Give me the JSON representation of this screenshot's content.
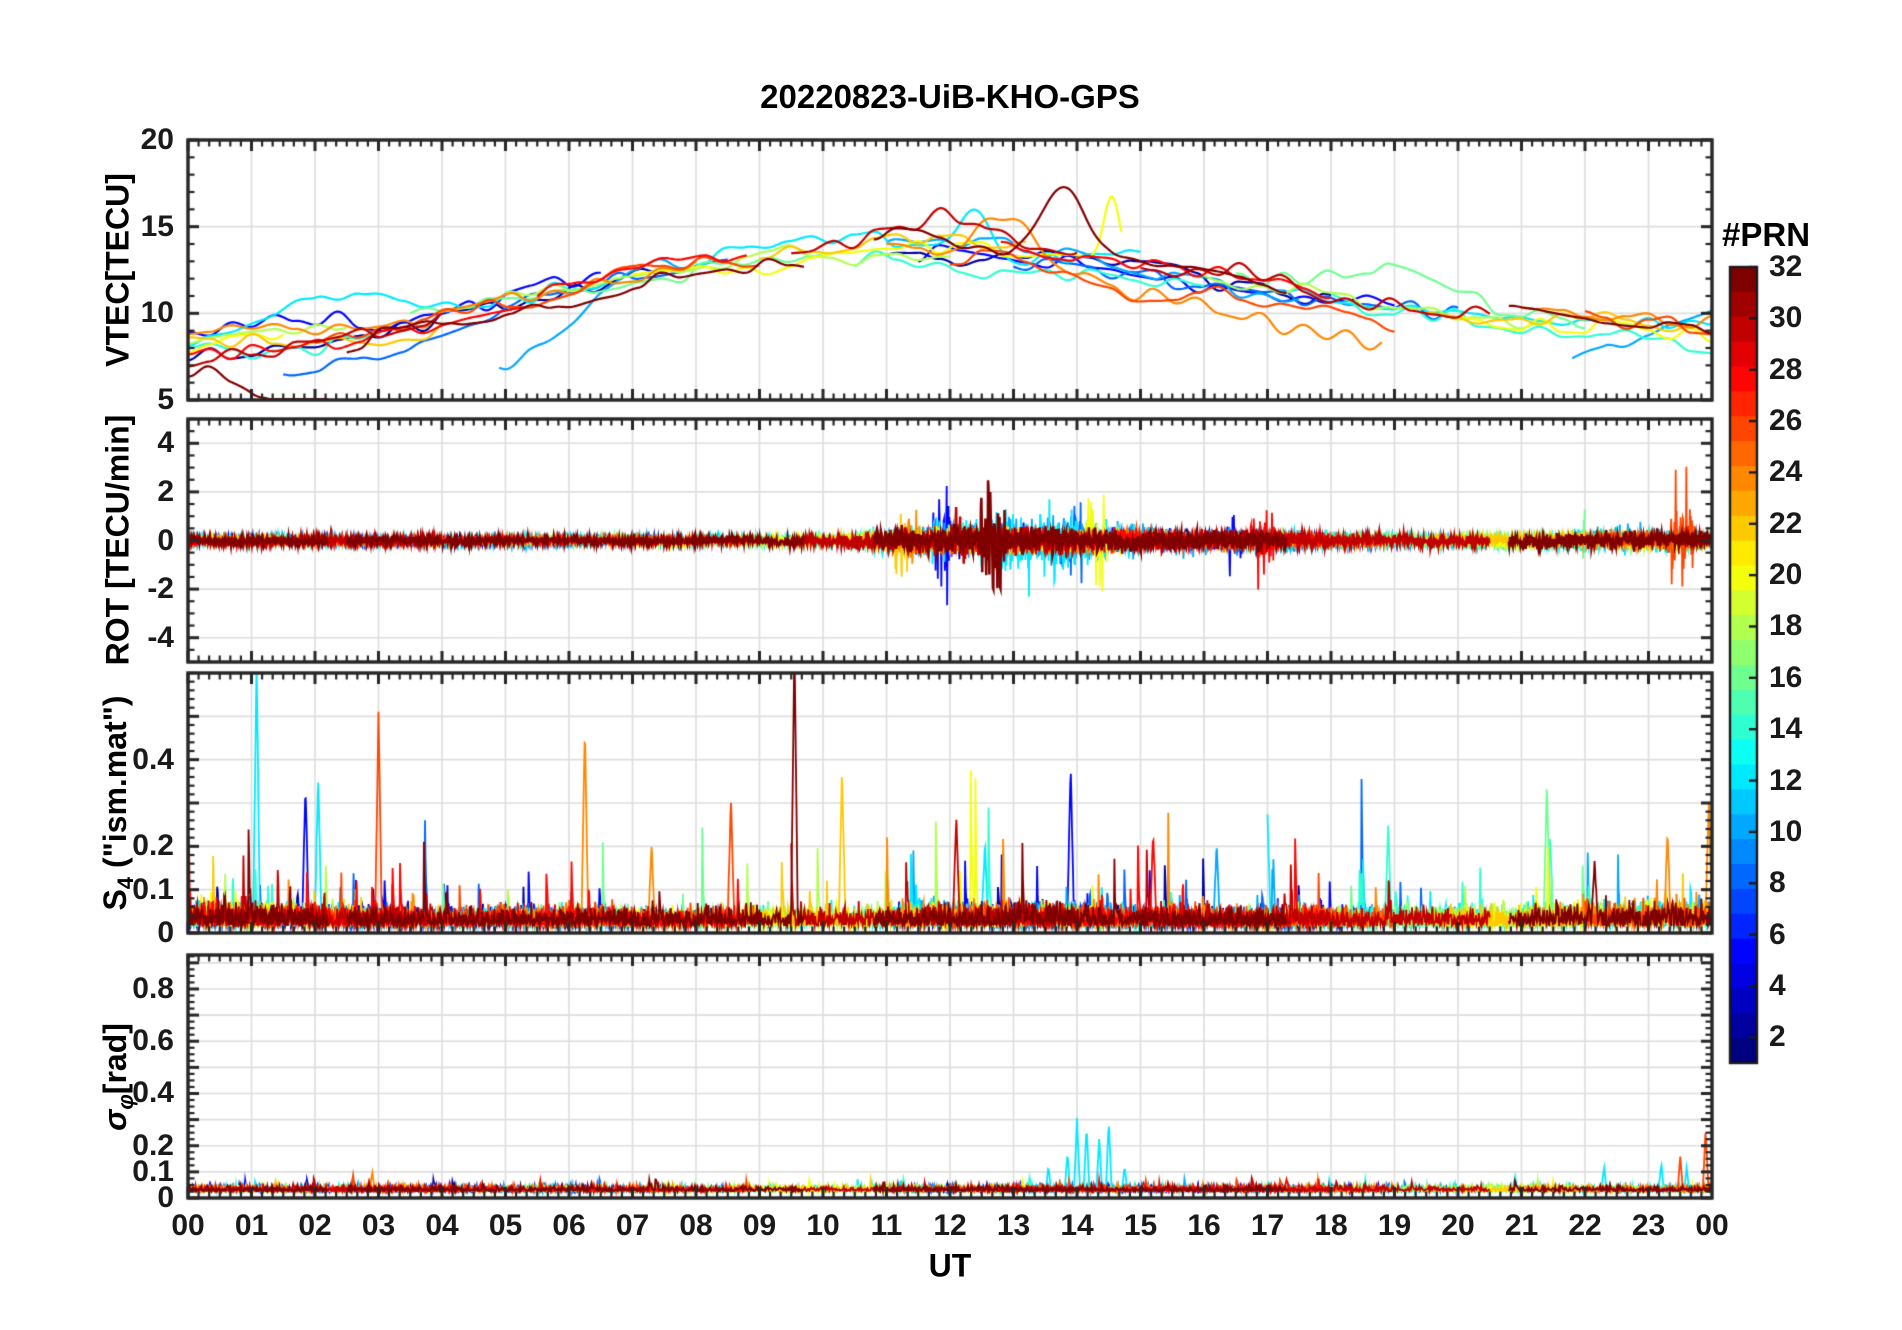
{
  "chart_data": {
    "type": "line",
    "title": "20220823-UiB-KHO-GPS",
    "xlabel": "UT",
    "xlim": [
      0,
      24
    ],
    "x_tick_labels": [
      "00",
      "01",
      "02",
      "03",
      "04",
      "05",
      "06",
      "07",
      "08",
      "09",
      "10",
      "11",
      "12",
      "13",
      "14",
      "15",
      "16",
      "17",
      "18",
      "19",
      "20",
      "21",
      "22",
      "23",
      "00"
    ],
    "grid": true,
    "seed": 20220823,
    "colorbar": {
      "title": "#PRN",
      "min": 1,
      "max": 32,
      "tick_values": [
        32,
        30,
        28,
        26,
        24,
        22,
        20,
        18,
        16,
        14,
        12,
        10,
        8,
        6,
        4,
        2
      ],
      "tick_labels": [
        "32",
        "30",
        "28",
        "26",
        "24",
        "22",
        "20",
        "18",
        "16",
        "14",
        "12",
        "10",
        "8",
        "6",
        "4",
        "2"
      ],
      "colormap": "jet",
      "colors": [
        "#000080",
        "#0000A0",
        "#0000C1",
        "#0000E2",
        "#0004FF",
        "#0025FF",
        "#0046FF",
        "#0067FF",
        "#0088FF",
        "#00A9FF",
        "#00C9FF",
        "#00EAFF",
        "#0CFFF3",
        "#2DFFD2",
        "#4EFFB1",
        "#6FFF90",
        "#90FF6F",
        "#B1FF4E",
        "#D2FF2D",
        "#F3FF0C",
        "#FFEA00",
        "#FFC900",
        "#FFA900",
        "#FF8800",
        "#FF6700",
        "#FF4600",
        "#FF2500",
        "#FF0400",
        "#E20000",
        "#C10000",
        "#A00000",
        "#800000"
      ]
    },
    "panels": [
      {
        "ylabel": "VTEC[TECU]",
        "ylim": [
          5,
          20
        ],
        "ytick_values": [
          5,
          10,
          15,
          20
        ],
        "ytick_labels": [
          "5",
          "10",
          "15",
          "20"
        ],
        "major_ticks": [
          5,
          10,
          15,
          20
        ],
        "grid_y": [
          10,
          15
        ],
        "minor_step": 1,
        "envelope_hourly_mean": [
          8.4,
          8.6,
          8.9,
          9.3,
          9.9,
          10.6,
          11.3,
          12.0,
          12.5,
          12.9,
          13.2,
          13.4,
          13.4,
          13.2,
          12.9,
          12.4,
          11.9,
          11.4,
          10.9,
          10.4,
          10.0,
          9.7,
          9.5,
          9.4,
          9.3
        ],
        "envelope_hourly_spread": [
          1.3,
          1.3,
          1.3,
          1.2,
          1.2,
          1.2,
          1.1,
          1.1,
          1.0,
          1.0,
          1.0,
          1.0,
          1.1,
          1.2,
          1.2,
          1.2,
          1.1,
          1.1,
          1.0,
          1.0,
          1.0,
          1.0,
          1.0,
          1.0,
          1.0
        ],
        "peaks": [
          {
            "prn": 32,
            "t": 13.8,
            "amp": 4.0,
            "w": 0.35
          },
          {
            "prn": 12,
            "t": 12.4,
            "amp": 2.8,
            "w": 0.25
          },
          {
            "prn": 20,
            "t": 14.55,
            "amp": 3.0,
            "w": 0.12
          },
          {
            "prn": 24,
            "t": 12.9,
            "amp": 2.2,
            "w": 0.4
          },
          {
            "prn": 30,
            "t": 12.1,
            "amp": 1.5,
            "w": 0.5
          },
          {
            "prn": 10,
            "t": 6.9,
            "amp": 1.2,
            "w": 0.5
          },
          {
            "prn": 12,
            "t": 2.3,
            "amp": 1.6,
            "w": 0.7
          },
          {
            "prn": 16,
            "t": 18.7,
            "amp": 1.6,
            "w": 0.8
          },
          {
            "prn": 32,
            "t": 1.6,
            "amp": -1.6,
            "w": 0.45
          }
        ]
      },
      {
        "ylabel": "ROT [TECU/min]",
        "ylim": [
          -5,
          5
        ],
        "ytick_values": [
          -4,
          -2,
          0,
          2,
          4
        ],
        "ytick_labels": [
          "-4",
          "-2",
          "0",
          "2",
          "4"
        ],
        "major_ticks": [
          -4,
          -2,
          0,
          2,
          4
        ],
        "grid_y": [
          -4,
          -2,
          0,
          2,
          4
        ],
        "minor_step": 0.5,
        "amp_hourly": [
          0.1,
          0.1,
          0.1,
          0.1,
          0.1,
          0.11,
          0.1,
          0.1,
          0.1,
          0.11,
          0.13,
          0.3,
          0.45,
          0.42,
          0.4,
          0.35,
          0.3,
          0.28,
          0.18,
          0.17,
          0.16,
          0.2,
          0.25,
          0.3,
          0.25
        ],
        "bursts": [
          {
            "prn": 32,
            "t0": 12.45,
            "t1": 12.9,
            "amp": 3.2
          },
          {
            "prn": 30,
            "t0": 12.0,
            "t1": 12.3,
            "amp": 1.6
          },
          {
            "prn": 12,
            "t0": 12.1,
            "t1": 14.7,
            "amp": 1.7
          },
          {
            "prn": 10,
            "t0": 13.2,
            "t1": 14.6,
            "amp": 1.4
          },
          {
            "prn": 5,
            "t0": 11.7,
            "t1": 12.1,
            "amp": 2.2
          },
          {
            "prn": 8,
            "t0": 13.6,
            "t1": 14.2,
            "amp": 1.7
          },
          {
            "prn": 20,
            "t0": 14.1,
            "t1": 14.5,
            "amp": 2.6
          },
          {
            "prn": 20,
            "t0": 5.3,
            "t1": 5.65,
            "amp": 1.2
          },
          {
            "prn": 22,
            "t0": 11.0,
            "t1": 11.4,
            "amp": 1.5
          },
          {
            "prn": 24,
            "t0": 11.2,
            "t1": 11.6,
            "amp": 1.4
          },
          {
            "prn": 28,
            "t0": 16.7,
            "t1": 17.15,
            "amp": 1.6
          },
          {
            "prn": 26,
            "t0": 23.3,
            "t1": 23.75,
            "amp": 3.0
          },
          {
            "prn": 16,
            "t0": 21.95,
            "t1": 22.1,
            "amp": 2.6
          },
          {
            "prn": 12,
            "t0": 15.0,
            "t1": 15.5,
            "amp": 1.2
          },
          {
            "prn": 5,
            "t0": 16.3,
            "t1": 16.6,
            "amp": 1.3
          }
        ]
      },
      {
        "ylabel_parts": {
          "pre": "S",
          "sub": "4",
          "post": " (\"ism.mat\")"
        },
        "ylim": [
          0,
          0.6
        ],
        "ytick_values": [
          0,
          0.1,
          0.2,
          0.4
        ],
        "ytick_labels": [
          "0",
          "0.1",
          "0.2",
          "0.4"
        ],
        "major_ticks": [
          0,
          0.1,
          0.2,
          0.3,
          0.4,
          0.5
        ],
        "grid_y": [
          0.1,
          0.2,
          0.3,
          0.4,
          0.5
        ],
        "minor_step": 0.02,
        "baseline": 0.035,
        "activity_hourly": [
          1.3,
          1.2,
          1.1,
          1.0,
          0.9,
          1.0,
          1.0,
          0.9,
          0.9,
          1.0,
          1.0,
          1.1,
          1.2,
          1.2,
          1.1,
          1.0,
          1.0,
          1.0,
          0.9,
          1.0,
          1.0,
          1.1,
          1.2,
          1.3,
          1.3
        ],
        "spikes": [
          {
            "t": 1.08,
            "prn": 12,
            "v": 0.62
          },
          {
            "t": 1.85,
            "prn": 5,
            "v": 0.33
          },
          {
            "t": 2.05,
            "prn": 12,
            "v": 0.36
          },
          {
            "t": 3.0,
            "prn": 26,
            "v": 0.5
          },
          {
            "t": 5.35,
            "prn": 28,
            "v": 0.26
          },
          {
            "t": 6.25,
            "prn": 24,
            "v": 0.47
          },
          {
            "t": 7.3,
            "prn": 24,
            "v": 0.2
          },
          {
            "t": 8.55,
            "prn": 26,
            "v": 0.3
          },
          {
            "t": 9.3,
            "prn": 8,
            "v": 0.28
          },
          {
            "t": 9.55,
            "prn": 32,
            "v": 0.66
          },
          {
            "t": 10.3,
            "prn": 22,
            "v": 0.37
          },
          {
            "t": 11.15,
            "prn": 5,
            "v": 0.27
          },
          {
            "t": 12.1,
            "prn": 30,
            "v": 0.26
          },
          {
            "t": 12.55,
            "prn": 12,
            "v": 0.2
          },
          {
            "t": 13.9,
            "prn": 5,
            "v": 0.38
          },
          {
            "t": 14.8,
            "prn": 30,
            "v": 0.2
          },
          {
            "t": 15.2,
            "prn": 28,
            "v": 0.22
          },
          {
            "t": 16.2,
            "prn": 10,
            "v": 0.2
          },
          {
            "t": 17.0,
            "prn": 12,
            "v": 0.26
          },
          {
            "t": 18.9,
            "prn": 14,
            "v": 0.23
          },
          {
            "t": 19.3,
            "prn": 24,
            "v": 0.2
          },
          {
            "t": 21.1,
            "prn": 30,
            "v": 0.18
          },
          {
            "t": 21.4,
            "prn": 16,
            "v": 0.34
          },
          {
            "t": 21.45,
            "prn": 14,
            "v": 0.22
          },
          {
            "t": 22.2,
            "prn": 18,
            "v": 0.39
          },
          {
            "t": 22.15,
            "prn": 32,
            "v": 0.16
          },
          {
            "t": 23.3,
            "prn": 24,
            "v": 0.22
          },
          {
            "t": 23.9,
            "prn": 8,
            "v": 0.26
          },
          {
            "t": 23.95,
            "prn": 24,
            "v": 0.3
          }
        ]
      },
      {
        "ylabel_parts": {
          "pre": "σ",
          "sub": "φ",
          "post": "[rad]"
        },
        "ylim": [
          0,
          0.93
        ],
        "ytick_values": [
          0,
          0.1,
          0.2,
          0.4,
          0.6,
          0.8
        ],
        "ytick_labels": [
          "0",
          "0.1",
          "0.2",
          "0.4",
          "0.6",
          "0.8"
        ],
        "major_ticks": [
          0,
          0.1,
          0.2,
          0.3,
          0.4,
          0.5,
          0.6,
          0.7,
          0.8,
          0.9
        ],
        "grid_y": [
          0.1,
          0.2,
          0.3,
          0.4,
          0.5,
          0.6,
          0.7,
          0.8,
          0.9
        ],
        "minor_step": 0.025,
        "baseline": 0.04,
        "spikes": [
          {
            "t": 0.35,
            "prn": 5,
            "v": 0.06
          },
          {
            "t": 2.6,
            "prn": 26,
            "v": 0.08
          },
          {
            "t": 2.9,
            "prn": 24,
            "v": 0.1
          },
          {
            "t": 12.35,
            "prn": 8,
            "v": 0.09
          },
          {
            "t": 13.55,
            "prn": 12,
            "v": 0.12
          },
          {
            "t": 13.85,
            "prn": 12,
            "v": 0.17
          },
          {
            "t": 14.0,
            "prn": 12,
            "v": 0.3
          },
          {
            "t": 14.15,
            "prn": 12,
            "v": 0.27
          },
          {
            "t": 14.35,
            "prn": 12,
            "v": 0.23
          },
          {
            "t": 14.5,
            "prn": 12,
            "v": 0.29
          },
          {
            "t": 14.75,
            "prn": 12,
            "v": 0.12
          },
          {
            "t": 17.3,
            "prn": 28,
            "v": 0.07
          },
          {
            "t": 20.9,
            "prn": 12,
            "v": 0.08
          },
          {
            "t": 22.3,
            "prn": 12,
            "v": 0.12
          },
          {
            "t": 23.2,
            "prn": 12,
            "v": 0.13
          },
          {
            "t": 23.6,
            "prn": 12,
            "v": 0.11
          },
          {
            "t": 23.5,
            "prn": 26,
            "v": 0.15
          },
          {
            "t": 23.9,
            "prn": 26,
            "v": 0.26
          }
        ]
      }
    ],
    "tracks": [
      {
        "prn": 2,
        "t0": 0,
        "t1": 7.5,
        "off0": -0.3,
        "off1": -0.1
      },
      {
        "prn": 2,
        "t0": 11,
        "t1": 18,
        "off0": 0.1,
        "off1": 0.0
      },
      {
        "prn": 5,
        "t0": 0,
        "t1": 6.5,
        "off0": 0.4,
        "off1": 0.2
      },
      {
        "prn": 5,
        "t0": 11.5,
        "t1": 19,
        "off0": 0.2,
        "off1": -0.2
      },
      {
        "prn": 8,
        "t0": 1.5,
        "t1": 8.5,
        "off0": -1.5,
        "off1": 0.5
      },
      {
        "prn": 8,
        "t0": 13,
        "t1": 20,
        "off0": -0.1,
        "off1": -0.4
      },
      {
        "prn": 10,
        "t0": 4.9,
        "t1": 7.9,
        "off0": -2.6,
        "off1": 0.2
      },
      {
        "prn": 10,
        "t0": 11,
        "t1": 17.5,
        "off0": 0.5,
        "off1": -0.6
      },
      {
        "prn": 10,
        "t0": 21.8,
        "t1": 24,
        "off0": -2.4,
        "off1": 1.2
      },
      {
        "prn": 12,
        "t0": 0,
        "t1": 6.6,
        "off0": 0.1,
        "off1": 0.1
      },
      {
        "prn": 12,
        "t0": 8,
        "t1": 15,
        "off0": 0.7,
        "off1": 0.3
      },
      {
        "prn": 12,
        "t0": 17,
        "t1": 24,
        "off0": -0.2,
        "off1": 0.1
      },
      {
        "prn": 14,
        "t0": 0,
        "t1": 3,
        "off0": -0.4,
        "off1": -0.4
      },
      {
        "prn": 14,
        "t0": 10.5,
        "t1": 16,
        "off0": -0.6,
        "off1": -0.5
      },
      {
        "prn": 14,
        "t0": 18,
        "t1": 24,
        "off0": 0.2,
        "off1": -0.7
      },
      {
        "prn": 16,
        "t0": 3.5,
        "t1": 10,
        "off0": 0.3,
        "off1": 0.2
      },
      {
        "prn": 16,
        "t0": 16.5,
        "t1": 22,
        "off0": 0.4,
        "off1": 0.3
      },
      {
        "prn": 18,
        "t0": 0,
        "t1": 2.5,
        "off0": 0.2,
        "off1": 0.2
      },
      {
        "prn": 18,
        "t0": 5,
        "t1": 12,
        "off0": 0.2,
        "off1": 0.1
      },
      {
        "prn": 18,
        "t0": 16,
        "t1": 21.5,
        "off0": -0.2,
        "off1": -0.4
      },
      {
        "prn": 20,
        "t0": 0,
        "t1": 1.5,
        "off0": 0.0,
        "off1": 0.0
      },
      {
        "prn": 20,
        "t0": 7,
        "t1": 14.7,
        "off0": 0.2,
        "off1": 0.4
      },
      {
        "prn": 20,
        "t0": 20,
        "t1": 24,
        "off0": -0.3,
        "off1": -0.2
      },
      {
        "prn": 22,
        "t0": 0,
        "t1": 4,
        "off0": -0.1,
        "off1": -0.3
      },
      {
        "prn": 22,
        "t0": 9,
        "t1": 13.2,
        "off0": 0.4,
        "off1": 0.6
      },
      {
        "prn": 22,
        "t0": 19.5,
        "t1": 24,
        "off0": -0.2,
        "off1": -0.3
      },
      {
        "prn": 24,
        "t0": 0,
        "t1": 8,
        "off0": 0.0,
        "off1": 0.2
      },
      {
        "prn": 24,
        "t0": 11,
        "t1": 18.8,
        "off0": 0.6,
        "off1": -1.9
      },
      {
        "prn": 24,
        "t0": 21,
        "t1": 24,
        "off0": 0.4,
        "off1": 0.2
      },
      {
        "prn": 26,
        "t0": 2,
        "t1": 9,
        "off0": 0.1,
        "off1": 0.3
      },
      {
        "prn": 26,
        "t0": 12,
        "t1": 19,
        "off0": -0.4,
        "off1": -1.2
      },
      {
        "prn": 26,
        "t0": 22,
        "t1": 24,
        "off0": 0.1,
        "off1": 0.0
      },
      {
        "prn": 28,
        "t0": 0,
        "t1": 5.3,
        "off0": -0.6,
        "off1": -0.5
      },
      {
        "prn": 28,
        "t0": 5.5,
        "t1": 8.8,
        "off0": 0.2,
        "off1": 1.1
      },
      {
        "prn": 28,
        "t0": 12.8,
        "t1": 18,
        "off0": 0.6,
        "off1": 0.3
      },
      {
        "prn": 30,
        "t0": 0,
        "t1": 4,
        "off0": -0.7,
        "off1": -0.6
      },
      {
        "prn": 30,
        "t0": 9.5,
        "t1": 14,
        "off0": 0.6,
        "off1": 0.5
      },
      {
        "prn": 30,
        "t0": 15,
        "t1": 20.5,
        "off0": 0.3,
        "off1": 0.2
      },
      {
        "prn": 32,
        "t0": 0,
        "t1": 2.2,
        "off0": -1.2,
        "off1": -2.4
      },
      {
        "prn": 32,
        "t0": 2.5,
        "t1": 9.7,
        "off0": -0.5,
        "off1": -0.2
      },
      {
        "prn": 32,
        "t0": 10.8,
        "t1": 17.3,
        "off0": 0.8,
        "off1": 0.6
      },
      {
        "prn": 32,
        "t0": 20.8,
        "t1": 24,
        "off0": 0.8,
        "off1": 0.3
      }
    ]
  }
}
